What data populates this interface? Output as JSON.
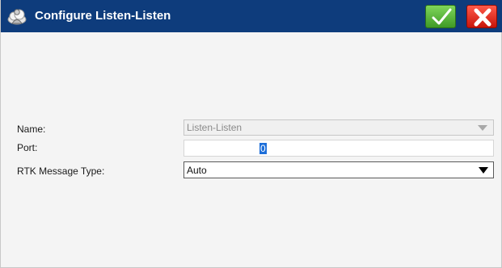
{
  "window": {
    "title": "Configure Listen-Listen"
  },
  "titlebar": {
    "ok_icon": "checkmark-icon",
    "cancel_icon": "x-icon",
    "app_icon": "cloud-person-icon",
    "colors": {
      "background": "#0e3c7c",
      "ok": "#4fb233",
      "cancel": "#e0261a"
    }
  },
  "form": {
    "name": {
      "label": "Name:",
      "value": "Listen-Listen",
      "enabled": false
    },
    "port": {
      "label": "Port:",
      "value": "0",
      "selected": true
    },
    "rtk_message_type": {
      "label": "RTK Message Type:",
      "value": "Auto"
    }
  }
}
